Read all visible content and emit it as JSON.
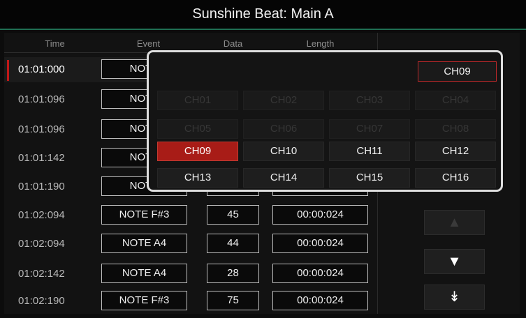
{
  "title": "Sunshine Beat: Main A",
  "columns": {
    "time": "Time",
    "event": "Event",
    "data": "Data",
    "length": "Length"
  },
  "rows": [
    {
      "time": "01:01:000",
      "event": "NOTE",
      "data": "",
      "length": "",
      "selected": true
    },
    {
      "time": "01:01:096",
      "event": "NOTE",
      "data": "",
      "length": ""
    },
    {
      "time": "01:01:096",
      "event": "NOTE",
      "data": "",
      "length": ""
    },
    {
      "time": "01:01:142",
      "event": "NOTE",
      "data": "",
      "length": ""
    },
    {
      "time": "01:01:190",
      "event": "NOTE",
      "data": "",
      "length": ""
    },
    {
      "time": "01:02:094",
      "event": "NOTE F#3",
      "data": "45",
      "length": "00:00:024"
    },
    {
      "time": "01:02:094",
      "event": "NOTE A4",
      "data": "44",
      "length": "00:00:024"
    },
    {
      "time": "01:02:142",
      "event": "NOTE A4",
      "data": "28",
      "length": "00:00:024"
    },
    {
      "time": "01:02:190",
      "event": "NOTE F#3",
      "data": "75",
      "length": "00:00:024"
    }
  ],
  "scroll": {
    "up_icon": "▲",
    "up_icon_name": "triangle-up-icon",
    "down_icon": "▼",
    "down_icon_name": "triangle-down-icon",
    "end_icon": "↡",
    "end_icon_name": "double-chevron-down-icon"
  },
  "popup": {
    "current_channel": "CH09",
    "channels": [
      {
        "label": "CH01",
        "state": "disabled"
      },
      {
        "label": "CH02",
        "state": "disabled"
      },
      {
        "label": "CH03",
        "state": "disabled"
      },
      {
        "label": "CH04",
        "state": "disabled"
      },
      {
        "label": "CH05",
        "state": "disabled"
      },
      {
        "label": "CH06",
        "state": "disabled"
      },
      {
        "label": "CH07",
        "state": "disabled"
      },
      {
        "label": "CH08",
        "state": "disabled"
      },
      {
        "label": "CH09",
        "state": "selected"
      },
      {
        "label": "CH10",
        "state": "normal"
      },
      {
        "label": "CH11",
        "state": "normal"
      },
      {
        "label": "CH12",
        "state": "normal"
      },
      {
        "label": "CH13",
        "state": "normal"
      },
      {
        "label": "CH14",
        "state": "normal"
      },
      {
        "label": "CH15",
        "state": "normal"
      },
      {
        "label": "CH16",
        "state": "normal"
      }
    ]
  },
  "colors": {
    "accent_red": "#c01818",
    "title_line": "#1f6f53",
    "popup_border": "#dedede"
  }
}
